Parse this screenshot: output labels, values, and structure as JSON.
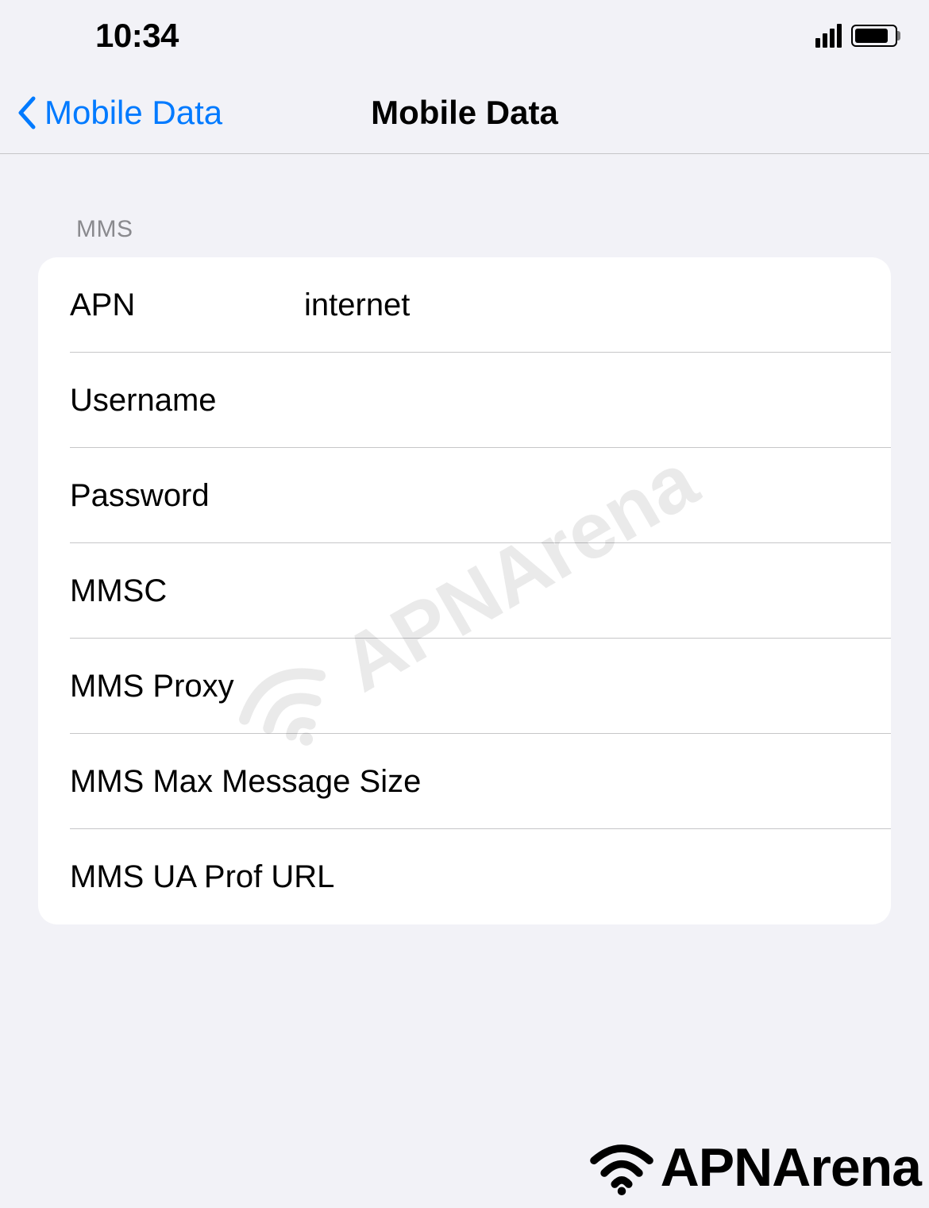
{
  "status_bar": {
    "time": "10:34"
  },
  "nav": {
    "back_label": "Mobile Data",
    "title": "Mobile Data"
  },
  "section": {
    "header": "MMS",
    "rows": [
      {
        "label": "APN",
        "value": "internet"
      },
      {
        "label": "Username",
        "value": ""
      },
      {
        "label": "Password",
        "value": ""
      },
      {
        "label": "MMSC",
        "value": ""
      },
      {
        "label": "MMS Proxy",
        "value": ""
      },
      {
        "label": "MMS Max Message Size",
        "value": ""
      },
      {
        "label": "MMS UA Prof URL",
        "value": ""
      }
    ]
  },
  "watermark": {
    "text": "APNArena"
  },
  "footer": {
    "text": "APNArena"
  }
}
